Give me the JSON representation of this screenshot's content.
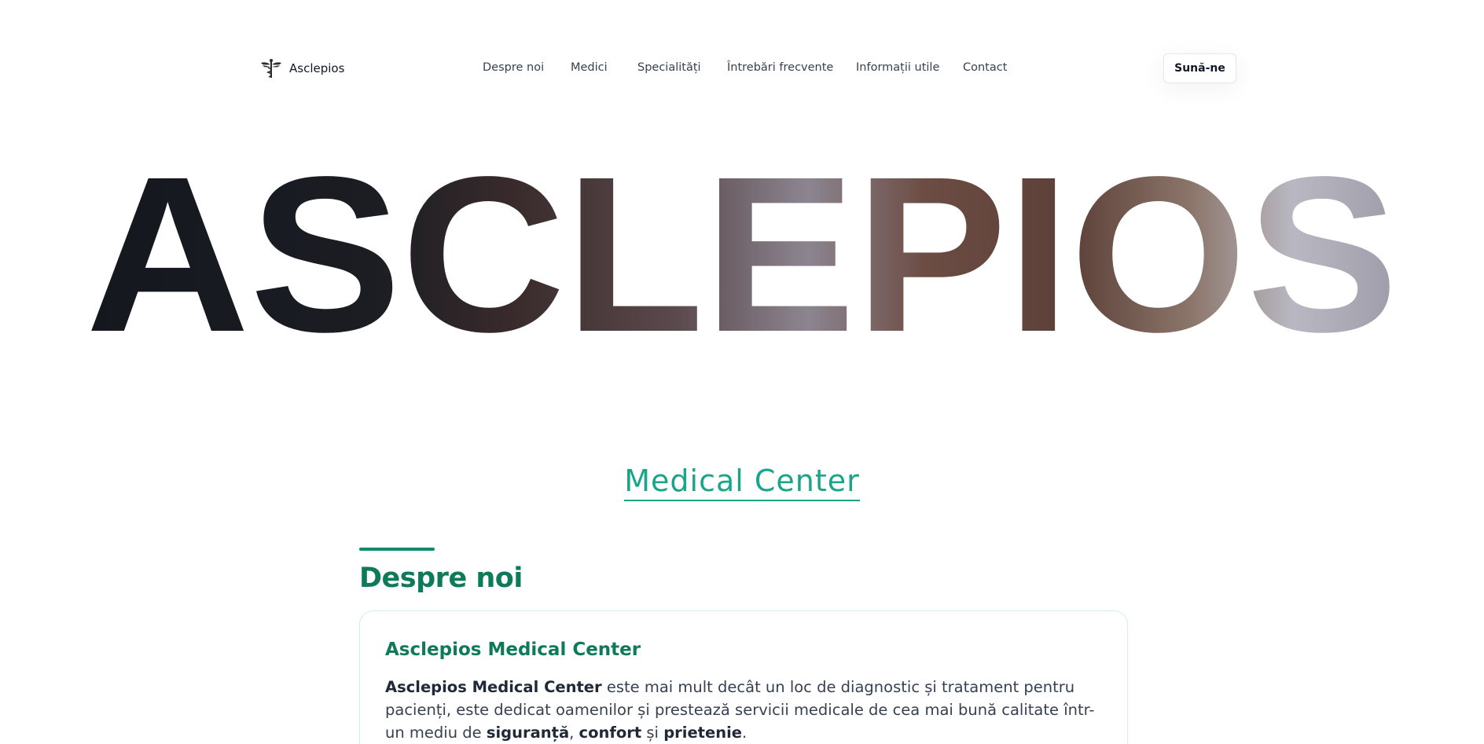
{
  "header": {
    "logo_text": "Asclepios",
    "nav": [
      "Despre noi",
      "Medici",
      "Specialități",
      "Întrebări frecvente",
      "Informații utile",
      "Contact"
    ],
    "call_button": "Sună-ne"
  },
  "hero": {
    "word": "ASCLEPIOS"
  },
  "medical_center": {
    "title": "Medical Center"
  },
  "about": {
    "section_title": "Despre noi",
    "card_title": "Asclepios Medical Center",
    "text_bold_1": "Asclepios Medical Center",
    "text_1": " este mai mult decât un loc de diagnostic și tratament pentru pacienți, este dedicat oamenilor și prestează servicii medicale de cea mai bună calitate într-un mediu de ",
    "text_bold_2": "siguranță",
    "text_2": ", ",
    "text_bold_3": "confort",
    "text_3": " și ",
    "text_bold_4": "prietenie",
    "text_4": "."
  },
  "colors": {
    "accent": "#1aa58a",
    "heading_green": "#0d7a5a",
    "hero_dark": "#15181f",
    "hero_warm": "#6b4a40",
    "hero_light": "#b4b3bc"
  }
}
